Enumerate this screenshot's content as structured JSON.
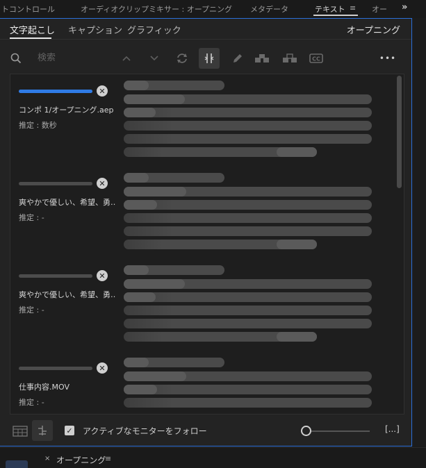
{
  "top_tabs": [
    {
      "label": "トコントロール"
    },
    {
      "label": "オーディオクリップミキサー : オープニング"
    },
    {
      "label": "メタデータ"
    },
    {
      "label": "テキスト"
    },
    {
      "label": "オー"
    }
  ],
  "top_tabs_menu": "≡",
  "top_tabs_overflow": "»",
  "sub_tabs": [
    {
      "label": "文字起こし"
    },
    {
      "label": "キャプション"
    },
    {
      "label": "グラフィック"
    }
  ],
  "sequence_name": "オープニング",
  "search": {
    "placeholder": "検索",
    "value": ""
  },
  "toolbar_icons": [
    "search-icon",
    "chevron-up-icon",
    "chevron-down-icon",
    "refresh-icon",
    "split-icon",
    "pencil-icon",
    "speaker-merge-icon",
    "speaker-split-icon",
    "cc-icon",
    "more-icon"
  ],
  "more_label": "•••",
  "clips": [
    {
      "filename": "コンポ 1/オープニング.aep",
      "estimate": "推定 : 数秒",
      "progress": 1.0
    },
    {
      "filename": "爽やかで優しい、希望、勇…",
      "estimate": "推定 : -",
      "progress": 0.0
    },
    {
      "filename": "爽やかで優しい、希望、勇…",
      "estimate": "推定 : -",
      "progress": 0.0
    },
    {
      "filename": "仕事内容.MOV",
      "estimate": "推定 : -",
      "progress": 0.0
    }
  ],
  "footer": {
    "follow_label": "アクティブなモニターをフォロー",
    "follow_checked": true,
    "more_button": "[...]"
  },
  "bottom_panel": {
    "close": "×",
    "tab_label": "オープニング",
    "menu": "≡"
  },
  "colors": {
    "accent": "#2f7be5",
    "panel_border": "#2b6fd9",
    "background": "#232323"
  }
}
